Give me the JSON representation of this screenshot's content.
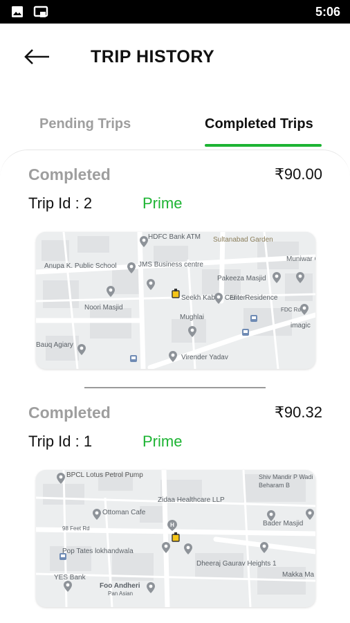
{
  "status_bar": {
    "time": "5:06"
  },
  "header": {
    "title": "TRIP HISTORY"
  },
  "tabs": [
    {
      "label": "Pending Trips",
      "active": false
    },
    {
      "label": "Completed Trips",
      "active": true
    }
  ],
  "colors": {
    "accent": "#1db433",
    "muted": "#9e9e9e"
  },
  "trips": [
    {
      "status": "Completed",
      "fare": "₹90.00",
      "trip_id": "Trip Id : 2",
      "type": "Prime",
      "map": {
        "labels": [
          "HDFC Bank ATM",
          "Sultanabad Garden",
          "Anupa K. Public School",
          "JMS Business centre",
          "Muniwar Cooperat",
          "Pakeeza Masjid",
          "Noori Masjid",
          "Seekh Kabab Center",
          "Elite Residence",
          "Mughlai",
          "imagic",
          "Bauq Agiary",
          "Virender Yadav",
          "FDC Rd"
        ]
      }
    },
    {
      "status": "Completed",
      "fare": "₹90.32",
      "trip_id": "Trip Id : 1",
      "type": "Prime",
      "map": {
        "labels": [
          "BPCL Lotus Petrol Pump",
          "Shiv Mandir P Wadi Beharam B",
          "Zidaa Healthcare LLP",
          "Ottoman Cafe",
          "98 Feet Rd",
          "Bader Masjid",
          "Pop Tates lokhandwala",
          "Dheeraj Gaurav Heights 1",
          "YES Bank",
          "Makka Ma",
          "Foo Andheri",
          "Pan Asian"
        ]
      }
    }
  ]
}
